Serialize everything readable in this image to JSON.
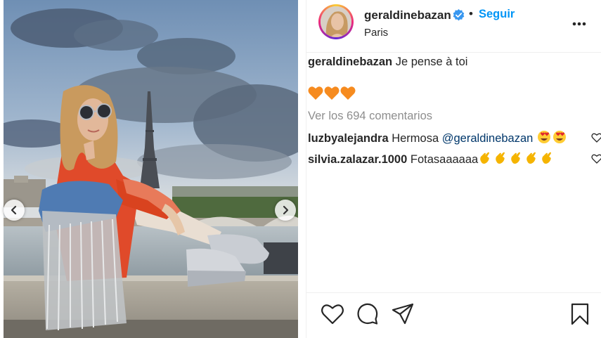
{
  "post": {
    "username": "geraldinebazan",
    "separator": "•",
    "follow_label": "Seguir",
    "location": "Paris",
    "more_icon": "more-horizontal-icon",
    "verified": true
  },
  "caption": {
    "username": "geraldinebazan",
    "text": "Je pense à toi",
    "emoji": [
      "orange-heart",
      "orange-heart",
      "orange-heart"
    ]
  },
  "view_comments": "Ver los 694 comentarios",
  "comments": [
    {
      "username": "luzbyalejandra",
      "text": "Hermosa ",
      "mention": "@geraldinebazan",
      "emoji": [
        "heart-eyes",
        "heart-eyes"
      ]
    },
    {
      "username": "silvia.zalazar.1000",
      "text": "Fotasaaaaaa",
      "emoji": [
        "clap",
        "clap",
        "clap",
        "clap",
        "clap"
      ]
    }
  ],
  "actions": [
    "like-icon",
    "comment-icon",
    "share-icon",
    "save-icon"
  ],
  "colors": {
    "accent": "#0095f6",
    "text": "#262626",
    "muted": "#8e8e8e",
    "mention": "#00376b",
    "heart": "#f68b1f"
  }
}
